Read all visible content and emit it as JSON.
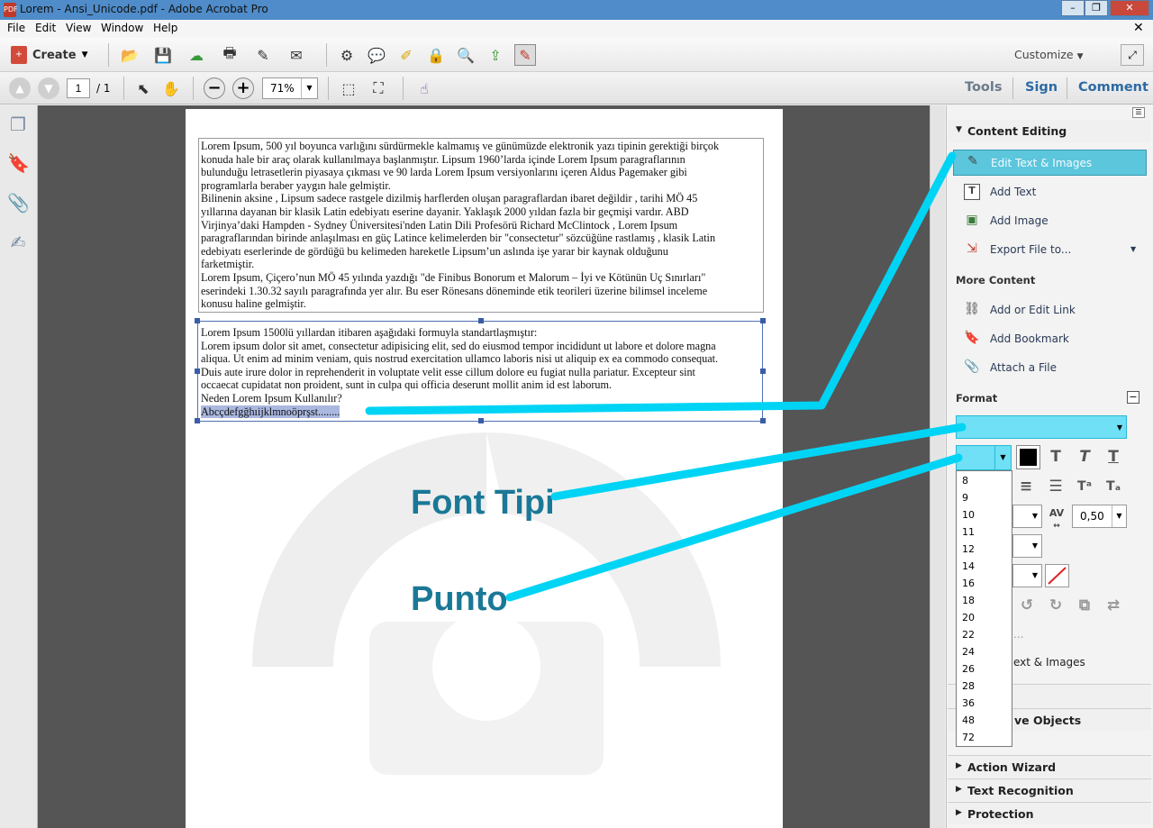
{
  "window": {
    "title": "Lorem - Ansi_Unicode.pdf - Adobe Acrobat Pro",
    "app_icon": "PDF"
  },
  "menu": [
    "File",
    "Edit",
    "View",
    "Window",
    "Help"
  ],
  "toolbar": {
    "create_label": "Create",
    "customize_label": "Customize"
  },
  "nav": {
    "page_current": "1",
    "page_total": "/ 1",
    "zoom": "71%"
  },
  "panes": {
    "tools": "Tools",
    "sign": "Sign",
    "comment": "Comment"
  },
  "document": {
    "block1": [
      "Lorem Ipsum, 500 yıl boyunca varlığını sürdürmekle kalmamış ve günümüzde elektronik yazı tipinin gerektiği birçok",
      "konuda hale bir araç olarak kullanılmaya başlanmıştır. Lipsum 1960’larda içinde Lorem Ipsum paragraflarının",
      "bulunduğu letrasetlerin piyasaya çıkması ve 90 larda Lorem Ipsum versiyonlarını içeren Aldus Pagemaker gibi",
      "programlarla beraber yaygın hale gelmiştir.",
      "Bilinenin aksine , Lipsum sadece rastgele dizilmiş harflerden oluşan paragraflardan ibaret değildir , tarihi MÖ 45",
      "yıllarına dayanan bir klasik Latin edebiyatı eserine dayanir. Yaklaşık 2000 yıldan fazla bir geçmişi vardır. ABD",
      "Virjinya’daki Hampden - Sydney Üniversitesi'nden Latin Dili Profesörü Richard McClintock , Lorem Ipsum",
      "paragraflarından birinde anlaşılması en güç Latince kelimelerden bir \"consectetur\" sözcüğüne rastlamış , klasik Latin",
      "edebiyatı eserlerinde de gördüğü bu kelimeden hareketle Lipsum’un aslında işe yarar bir kaynak olduğunu",
      "farketmiştir.",
      "Lorem Ipsum, Çiçero’nun MÖ 45 yılında yazdığı \"de Finibus Bonorum et Malorum – İyi ve Kötünün Uç Sınırları\"",
      "eserindeki 1.30.32 sayılı paragrafında yer alır. Bu eser Rönesans döneminde etik teorileri üzerine bilimsel inceleme",
      "konusu haline gelmiştir."
    ],
    "block2": [
      "Lorem Ipsum 1500lü yıllardan itibaren aşağıdaki formuyla standartlaşmıştır:",
      "Lorem ipsum dolor sit amet, consectetur adipisicing elit, sed do eiusmod tempor incididunt ut labore et dolore magna",
      "aliqua. Ut enim ad minim veniam, quis nostrud exercitation ullamco laboris nisi ut aliquip ex ea commodo consequat.",
      "Duis aute irure dolor in reprehenderit in voluptate velit esse cillum dolore eu fugiat nulla pariatur. Excepteur sint",
      "occaecat cupidatat non proident, sunt in culpa qui officia deserunt mollit anim id est laborum.",
      "Neden Lorem Ipsum Kullanılır?"
    ],
    "selected_text": "Abcçdefgğhıijklmnoöprşst........"
  },
  "callouts": {
    "font": "Font Tipi",
    "size": "Punto"
  },
  "right_panel": {
    "content_editing": "Content Editing",
    "edit_text_images": "Edit Text & Images",
    "add_text": "Add Text",
    "add_image": "Add Image",
    "export_file": "Export File to...",
    "more_content": "More Content",
    "add_edit_link": "Add or Edit Link",
    "add_bookmark": "Add Bookmark",
    "attach_file": "Attach a File",
    "format": "Format",
    "char_spacing": "0,50",
    "tooltip_size": "14",
    "partial_text_images": "ext & Images",
    "partial_ellipsis": "...",
    "partial_objects": "ve Objects",
    "action_wizard": "Action Wizard",
    "text_recognition": "Text Recognition",
    "protection": "Protection"
  },
  "font_sizes": [
    "8",
    "9",
    "10",
    "11",
    "12",
    "14",
    "16",
    "18",
    "20",
    "22",
    "24",
    "26",
    "28",
    "36",
    "48",
    "72"
  ],
  "colors": {
    "accent": "#00d4f5",
    "callout": "#1a7896",
    "highlight": "#5fd0e6"
  }
}
